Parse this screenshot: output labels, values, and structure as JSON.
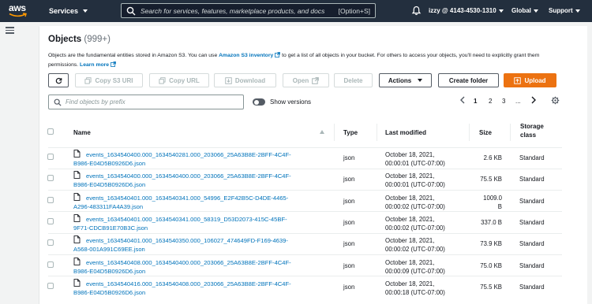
{
  "nav": {
    "logo": "aws",
    "services": "Services",
    "search_placeholder": "Search for services, features, marketplace products, and docs",
    "search_shortcut": "[Option+S]",
    "account": "izzy @ 4143-4530-1310",
    "region": "Global",
    "support": "Support"
  },
  "objects": {
    "title": "Objects",
    "count": "(999+)",
    "desc_prefix": "Objects are the fundamental entities stored in Amazon S3. You can use ",
    "inventory_link": "Amazon S3 inventory",
    "desc_suffix": " to get a list of all objects in your bucket. For others to access your objects, you'll need to explicitly grant them permissions. ",
    "learn_more": "Learn more"
  },
  "toolbar": {
    "copy_s3_uri": "Copy S3 URI",
    "copy_url": "Copy URL",
    "download": "Download",
    "open": "Open",
    "delete": "Delete",
    "actions": "Actions",
    "create_folder": "Create folder",
    "upload": "Upload"
  },
  "filter": {
    "placeholder": "Find objects by prefix",
    "show_versions": "Show versions"
  },
  "pagination": {
    "pages": [
      "1",
      "2",
      "3"
    ],
    "ellipsis": "...",
    "current": "1"
  },
  "table": {
    "headers": {
      "name": "Name",
      "type": "Type",
      "last_modified": "Last modified",
      "size": "Size",
      "storage_class_1": "Storage",
      "storage_class_2": "class"
    },
    "rows": [
      {
        "name_1": "events_1634540400.000_1634540281.000_203066_25A63B8E-2BFF-4C4F-",
        "name_2": "B986-E04D5B0926D6.json",
        "type": "json",
        "date": "October 18, 2021,",
        "time": "00:00:01 (UTC-07:00)",
        "size_1": "2.6 KB",
        "size_2": "",
        "storage_class": "Standard"
      },
      {
        "name_1": "events_1634540400.000_1634540400.000_203066_25A63B8E-2BFF-4C4F-",
        "name_2": "B986-E04D5B0926D6.json",
        "type": "json",
        "date": "October 18, 2021,",
        "time": "00:00:01 (UTC-07:00)",
        "size_1": "75.5 KB",
        "size_2": "",
        "storage_class": "Standard"
      },
      {
        "name_1": "events_1634540401.000_1634540341.000_54996_E2F42B5C-D4DE-4465-",
        "name_2": "A296-483311FA4A39.json",
        "type": "json",
        "date": "October 18, 2021,",
        "time": "00:00:02 (UTC-07:00)",
        "size_1": "1009.0",
        "size_2": "B",
        "storage_class": "Standard"
      },
      {
        "name_1": "events_1634540401.000_1634540341.000_58319_D53D2073-415C-45BF-",
        "name_2": "9F71-CDCB91E70B3C.json",
        "type": "json",
        "date": "October 18, 2021,",
        "time": "00:00:02 (UTC-07:00)",
        "size_1": "337.0 B",
        "size_2": "",
        "storage_class": "Standard"
      },
      {
        "name_1": "events_1634540401.000_1634540350.000_106027_474649FD-F169-4639-",
        "name_2": "A568-001A991C69EE.json",
        "type": "json",
        "date": "October 18, 2021,",
        "time": "00:00:02 (UTC-07:00)",
        "size_1": "73.9 KB",
        "size_2": "",
        "storage_class": "Standard"
      },
      {
        "name_1": "events_1634540408.000_1634540400.000_203066_25A63B8E-2BFF-4C4F-",
        "name_2": "B986-E04D5B0926D6.json",
        "type": "json",
        "date": "October 18, 2021,",
        "time": "00:00:09 (UTC-07:00)",
        "size_1": "75.0 KB",
        "size_2": "",
        "storage_class": "Standard"
      },
      {
        "name_1": "events_1634540416.000_1634540408.000_203066_25A63B8E-2BFF-4C4F-",
        "name_2": "B986-E04D5B0926D6.json",
        "type": "json",
        "date": "October 18, 2021,",
        "time": "00:00:18 (UTC-07:00)",
        "size_1": "75.5 KB",
        "size_2": "",
        "storage_class": "Standard"
      }
    ]
  }
}
